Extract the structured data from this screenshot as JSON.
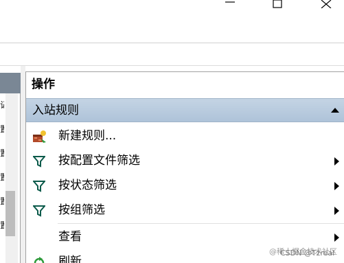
{
  "window_controls": {
    "minimize_icon": "minimize-icon",
    "maximize_icon": "maximize-icon",
    "close_icon": "close-icon"
  },
  "left_pane": {
    "visible_chars": [
      "记",
      "置",
      "置",
      "置",
      "置",
      "置"
    ]
  },
  "actions_panel": {
    "title": "操作",
    "section": {
      "label": "入站规则",
      "expanded": true
    },
    "items": [
      {
        "label": "新建规则...",
        "icon": "new-rule-icon",
        "has_submenu": false
      },
      {
        "label": "按配置文件筛选",
        "icon": "filter-icon",
        "has_submenu": true
      },
      {
        "label": "按状态筛选",
        "icon": "filter-icon",
        "has_submenu": true
      },
      {
        "label": "按组筛选",
        "icon": "filter-icon",
        "has_submenu": true
      },
      {
        "label": "查看",
        "icon": "",
        "has_submenu": true
      },
      {
        "label": "刷新",
        "icon": "refresh-icon",
        "has_submenu": false
      }
    ]
  },
  "watermark": "@稀土掘金技术社区",
  "watermark2": "CSDN @Tzreal"
}
